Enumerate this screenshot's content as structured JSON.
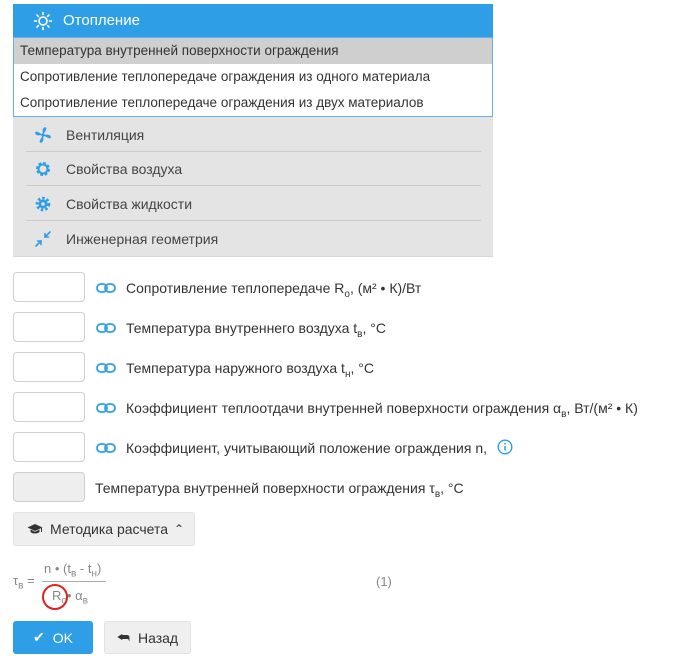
{
  "header": {
    "title": "Отопление",
    "icon": "sun-icon"
  },
  "dropdown": {
    "items": [
      "Температура внутренней поверхности ограждения",
      "Сопротивление теплопередаче ограждения из одного материала",
      "Сопротивление теплопередаче ограждения из двух материалов"
    ],
    "selected_index": 0
  },
  "menu": [
    {
      "label": "Вентиляция",
      "icon": "fan-icon"
    },
    {
      "label": "Свойства воздуха",
      "icon": "gear-icon"
    },
    {
      "label": "Свойства жидкости",
      "icon": "gear-icon"
    },
    {
      "label": "Инженерная геометрия",
      "icon": "compress-arrows-icon"
    }
  ],
  "inputs": [
    {
      "label_pre": "Сопротивление теплопередаче R",
      "sub": "о",
      "label_post": ", (м² • К)/Вт",
      "value": ""
    },
    {
      "label_pre": "Температура внутреннего воздуха t",
      "sub": "в",
      "label_post": ", °С",
      "value": ""
    },
    {
      "label_pre": "Температура наружного воздуха t",
      "sub": "н",
      "label_post": ", °С",
      "value": ""
    },
    {
      "label_pre": "Коэффициент теплоотдачи внутренней поверхности ограждения α",
      "sub": "в",
      "label_post": ", Вт/(м² • К)",
      "value": ""
    },
    {
      "label_pre": "Коэффициент, учитывающий положение ограждения n,",
      "sub": "",
      "label_post": "",
      "value": ""
    }
  ],
  "result": {
    "label_pre": "Температура внутренней поверхности ограждения τ",
    "sub": "в",
    "label_post": ", °С",
    "value": ""
  },
  "method_button": {
    "label": "Методика расчета"
  },
  "formula": {
    "lhs": "τ",
    "lhs_sub": "в",
    "eq": "=",
    "num_a": "n • (t",
    "num_a_sub": "в",
    "num_b": " - t",
    "num_b_sub": "н",
    "num_c": ")",
    "den_a": "R",
    "den_a_sub": "о",
    "den_b": "• α",
    "den_b_sub": "в",
    "number": "(1)"
  },
  "buttons": {
    "ok": "OK",
    "back": "Назад"
  },
  "colors": {
    "accent": "#2e9ee6",
    "highlight_circle": "#dd2222"
  }
}
